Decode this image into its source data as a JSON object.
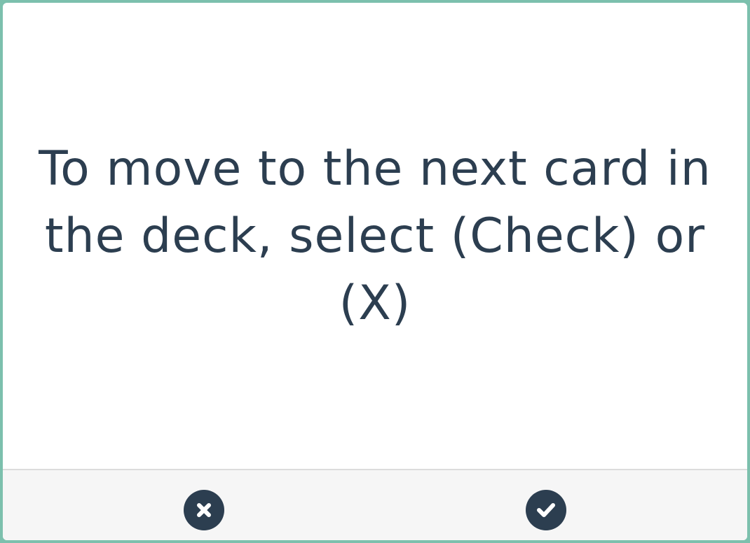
{
  "card": {
    "text": "To move to the next card in the deck, select (Check) or (X)"
  },
  "footer": {
    "buttons": [
      {
        "name": "x",
        "icon": "close-circle-icon"
      },
      {
        "name": "check",
        "icon": "check-circle-icon"
      }
    ]
  },
  "colors": {
    "frame_border": "#7cc0ad",
    "card_background": "#ffffff",
    "text": "#2c3e50",
    "footer_background": "#f6f6f6",
    "button": "#2c3e50"
  }
}
